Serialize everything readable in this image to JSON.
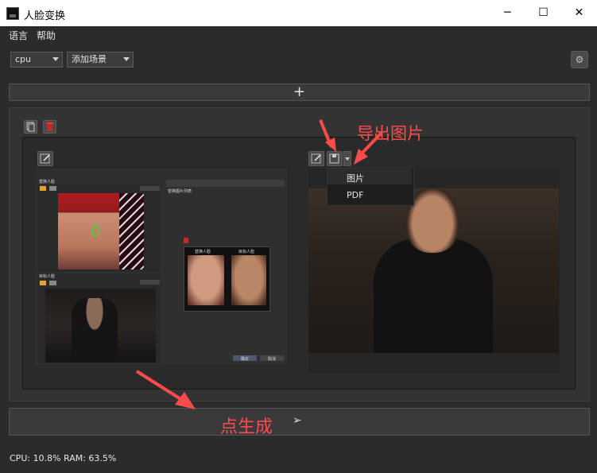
{
  "window": {
    "title": "人脸变换",
    "minimize": "─",
    "maximize": "☐",
    "close": "✕"
  },
  "menu": [
    "语言",
    "帮助"
  ],
  "toolbar": {
    "device": "cpu",
    "scene": "添加场景"
  },
  "add_bar": {
    "label": "+"
  },
  "annotations": {
    "export_label": "导出图片",
    "generate_label": "点生成"
  },
  "export_menu": {
    "items": [
      "图片",
      "PDF"
    ]
  },
  "thumbnail": {
    "source_label": "替换人脸",
    "target_label": "目标人脸",
    "list_label": "替换图片列表",
    "swap_source": "替换人脸",
    "swap_target": "目标人脸",
    "ok": "确定",
    "cancel": "取消"
  },
  "generate": {
    "icon": "send-icon"
  },
  "status": {
    "cpu": "CPU: 10.8%",
    "ram": "RAM: 63.5%"
  },
  "colors": {
    "accent_annotation": "#ff4b4b",
    "background": "#2b2b2b",
    "panel": "#333333"
  }
}
